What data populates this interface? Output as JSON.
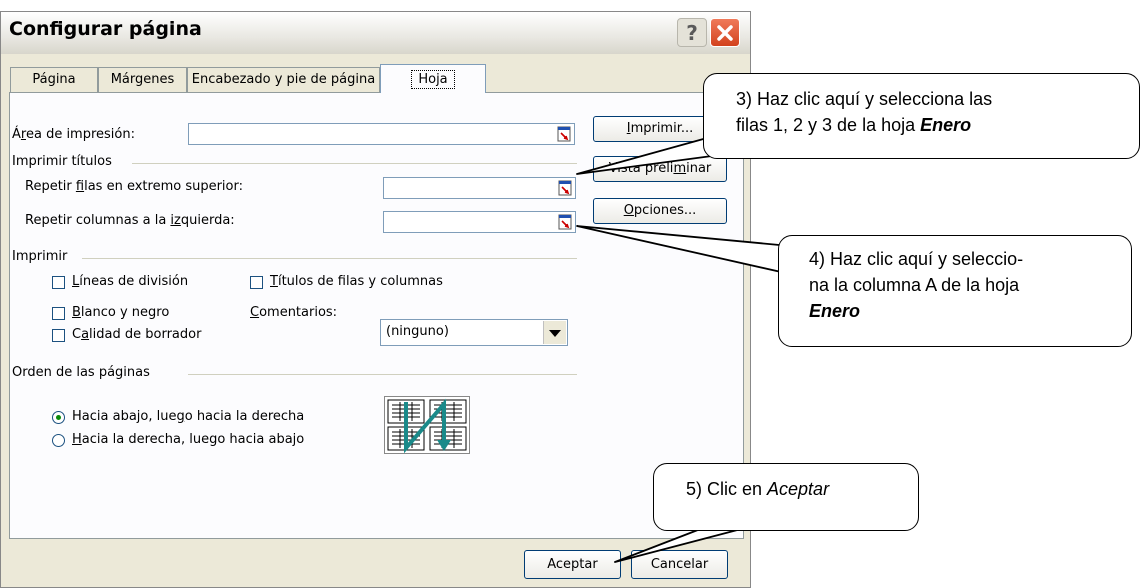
{
  "dialog": {
    "title": "Configurar página",
    "tabs": [
      "Página",
      "Márgenes",
      "Encabezado y pie de página",
      "Hoja"
    ],
    "print_area": {
      "label_pre": "Á",
      "label_u": "r",
      "label_post": "ea de impresión:",
      "value": ""
    },
    "print_titles": {
      "heading": "Imprimir títulos",
      "rows_label_pre": "Repetir ",
      "rows_label_u": "f",
      "rows_label_post": "ilas en extremo superior:",
      "cols_label_pre": "Repetir columnas a la ",
      "cols_label_u": "iz",
      "cols_label_post": "quierda:"
    },
    "print": {
      "heading": "Imprimir",
      "gridlines_u": "L",
      "gridlines_rest": "íneas de división",
      "bw_u": "B",
      "bw_rest": "lanco y negro",
      "draft_pre": "C",
      "draft_u": "a",
      "draft_rest": "lidad de borrador",
      "headings_u": "T",
      "headings_rest": "ítulos de filas y columnas",
      "comments_u": "C",
      "comments_rest": "omentarios:",
      "comments_value": "(ninguno)"
    },
    "page_order": {
      "heading": "Orden de las páginas",
      "option1_pre": "Hacia abajo, lue",
      "option1_u": "g",
      "option1_post": "o hacia la derecha",
      "option2_u": "H",
      "option2_rest": "acia la derecha, luego hacia abajo",
      "selected": "option1"
    },
    "side_buttons": {
      "print_u": "I",
      "print_rest": "mprimir...",
      "preview_pre": "Vista preli",
      "preview_u": "m",
      "preview_post": "inar",
      "options_u": "O",
      "options_rest": "pciones..."
    },
    "footer": {
      "ok": "Aceptar",
      "cancel": "Cancelar"
    }
  },
  "callouts": {
    "c3_line1": "3) Haz clic aquí y selecciona las",
    "c3_line2a": "filas 1, 2 y 3 de la hoja ",
    "c3_bold": "Enero",
    "c4_line1": "4) Haz clic aquí y seleccio-",
    "c4_line2": "na la columna A de la hoja",
    "c4_bold": "Enero",
    "c5_text": "5) Clic en ",
    "c5_italic": "Aceptar"
  },
  "colors": {
    "dialog_bg": "#ece9d8",
    "panel_bg": "#fcfcfe",
    "close_red": "#d2421e",
    "radio_dot": "#0a8a0a"
  },
  "icons": [
    "help-icon",
    "close-icon",
    "range-picker-icon",
    "dropdown-arrow-icon",
    "page-order-icon"
  ]
}
